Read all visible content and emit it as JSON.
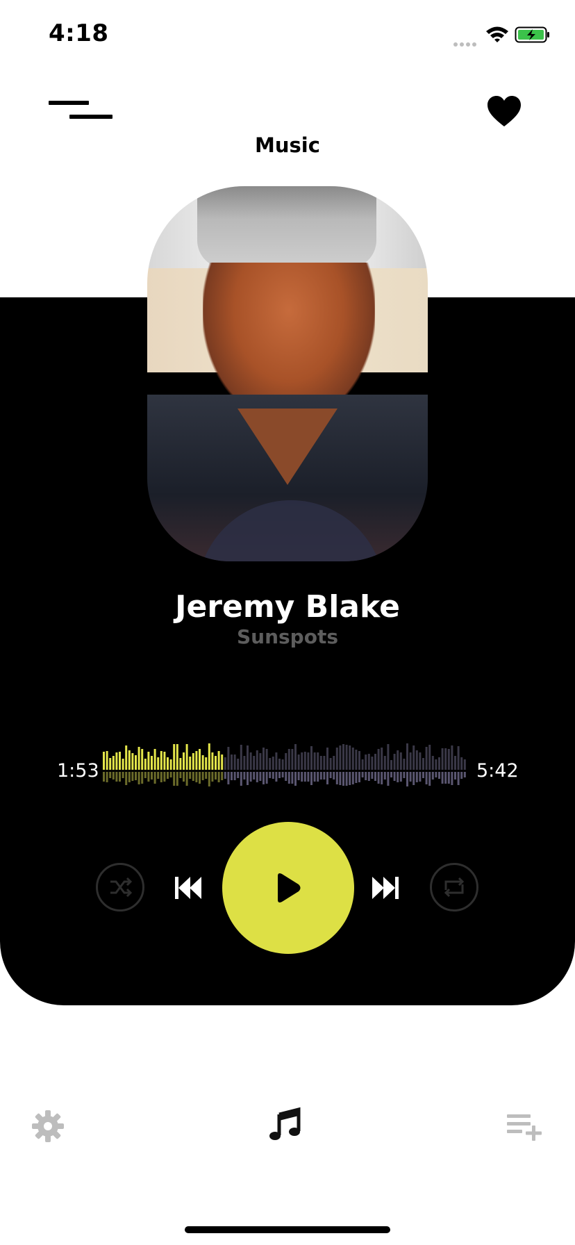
{
  "status_bar": {
    "time": "4:18"
  },
  "header": {
    "title": "Music"
  },
  "now_playing": {
    "artist": "Jeremy Blake",
    "track": "Sunspots",
    "elapsed": "1:53",
    "duration": "5:42",
    "progress": 0.33
  },
  "colors": {
    "accent": "#DDE045",
    "panel": "#000000",
    "played_wave": "#E4E64A",
    "unplayed_wave": "#3A3847"
  },
  "icons": {
    "menu": "menu-icon",
    "favorite": "heart-icon",
    "shuffle": "shuffle-icon",
    "previous": "skip-back-icon",
    "play": "play-icon",
    "next": "skip-forward-icon",
    "repeat": "repeat-icon",
    "settings": "gear-icon",
    "music": "music-note-icon",
    "playlist": "playlist-add-icon"
  },
  "bottom_nav": {
    "active": "music"
  }
}
